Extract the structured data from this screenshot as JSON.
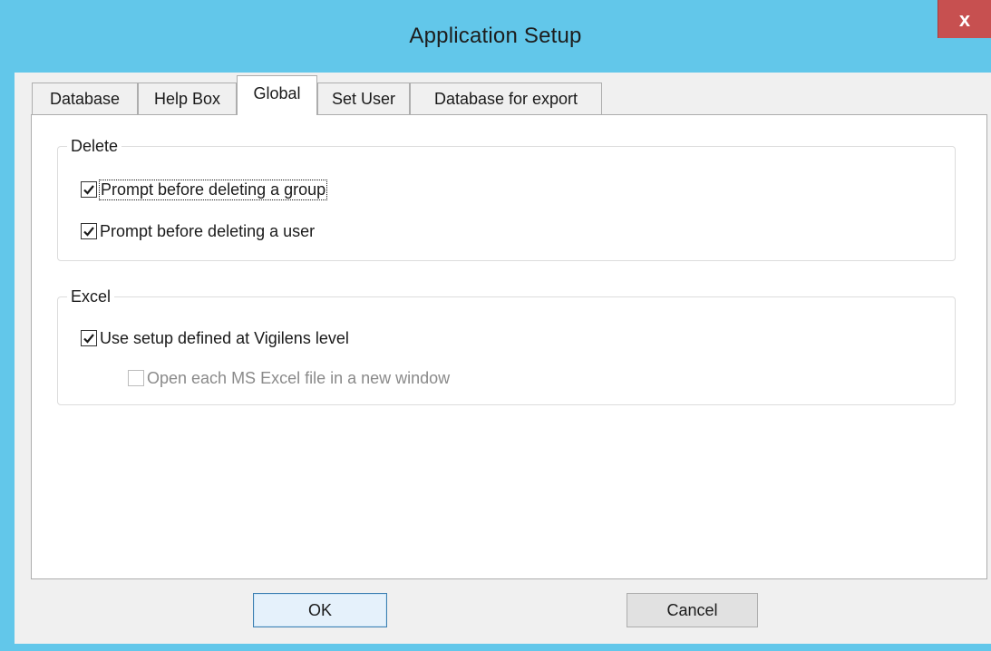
{
  "window": {
    "title": "Application Setup",
    "close_label": "x"
  },
  "tabs": [
    {
      "label": "Database",
      "active": false
    },
    {
      "label": "Help Box",
      "active": false
    },
    {
      "label": "Global",
      "active": true
    },
    {
      "label": "Set User",
      "active": false
    },
    {
      "label": "Database for export",
      "active": false
    }
  ],
  "groups": {
    "delete": {
      "title": "Delete",
      "options": [
        {
          "label": "Prompt before deleting a group",
          "checked": true,
          "enabled": true,
          "focused": true
        },
        {
          "label": "Prompt before deleting a user",
          "checked": true,
          "enabled": true,
          "focused": false
        }
      ]
    },
    "excel": {
      "title": "Excel",
      "options": [
        {
          "label": "Use setup defined at Vigilens level",
          "checked": true,
          "enabled": true,
          "focused": false
        },
        {
          "label": "Open each MS Excel file in a new window",
          "checked": false,
          "enabled": false,
          "focused": false
        }
      ]
    }
  },
  "buttons": {
    "ok_label": "OK",
    "cancel_label": "Cancel"
  },
  "colors": {
    "titlebar": "#62c7ea",
    "close_button": "#c75050",
    "dialog_background": "#f0f0f0",
    "panel_background": "#ffffff",
    "disabled_text": "#8a8a8a"
  }
}
